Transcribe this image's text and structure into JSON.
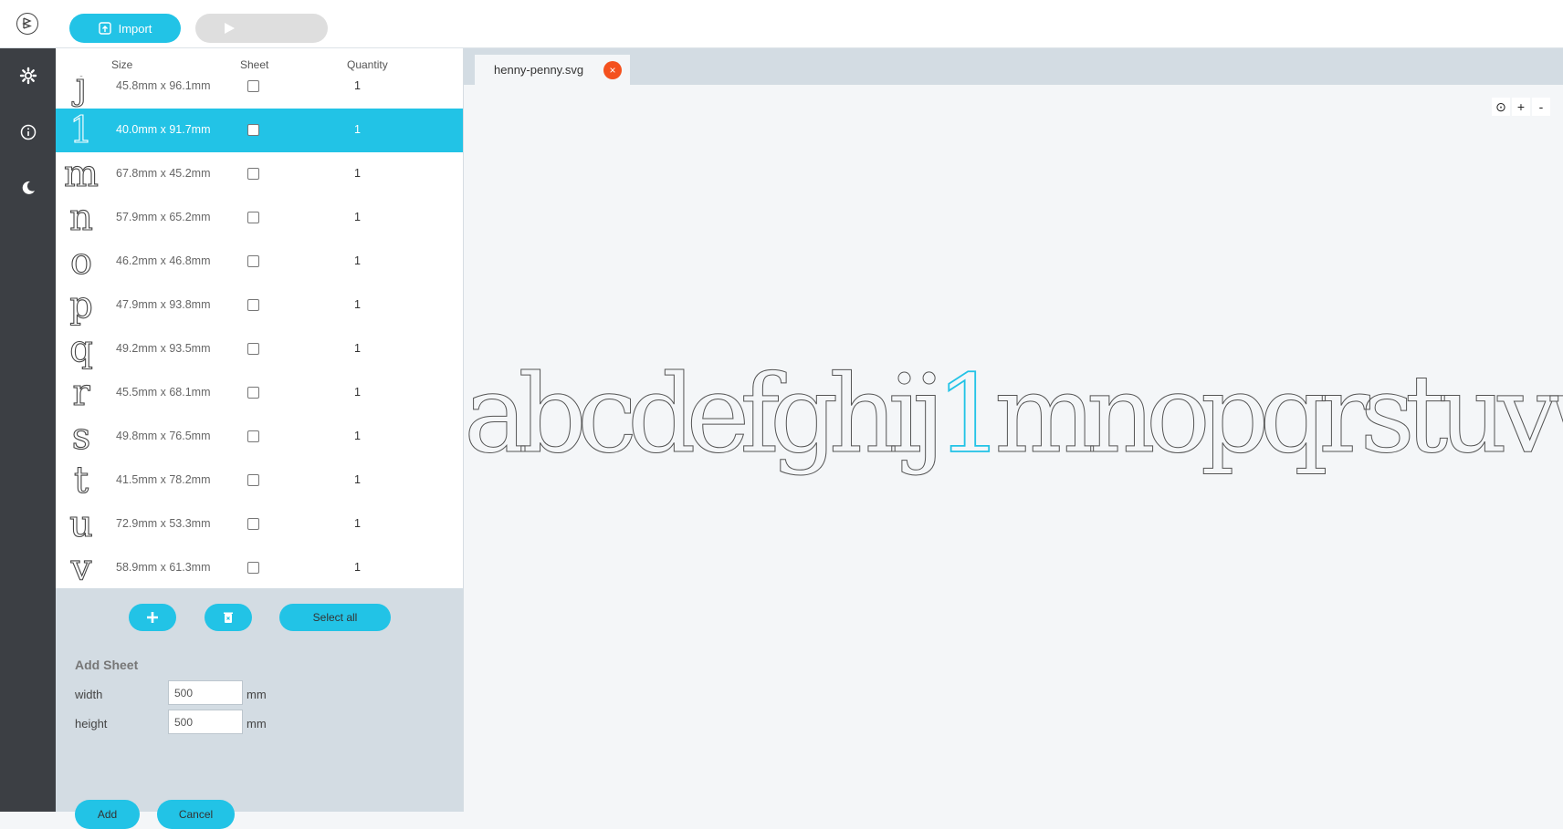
{
  "toolbar": {
    "import_label": "Import",
    "start_label": ""
  },
  "table": {
    "headers": {
      "size": "Size",
      "sheet": "Sheet",
      "quantity": "Quantity"
    },
    "rows": [
      {
        "glyph": "j",
        "size": "45.8mm x 96.1mm",
        "qty": "1"
      },
      {
        "glyph": "1",
        "size": "40.0mm x 91.7mm",
        "qty": "1",
        "selected": true
      },
      {
        "glyph": "m",
        "size": "67.8mm x 45.2mm",
        "qty": "1"
      },
      {
        "glyph": "n",
        "size": "57.9mm x 65.2mm",
        "qty": "1"
      },
      {
        "glyph": "o",
        "size": "46.2mm x 46.8mm",
        "qty": "1"
      },
      {
        "glyph": "p",
        "size": "47.9mm x 93.8mm",
        "qty": "1"
      },
      {
        "glyph": "q",
        "size": "49.2mm x 93.5mm",
        "qty": "1"
      },
      {
        "glyph": "r",
        "size": "45.5mm x 68.1mm",
        "qty": "1"
      },
      {
        "glyph": "s",
        "size": "49.8mm x 76.5mm",
        "qty": "1"
      },
      {
        "glyph": "t",
        "size": "41.5mm x 78.2mm",
        "qty": "1"
      },
      {
        "glyph": "u",
        "size": "72.9mm x 53.3mm",
        "qty": "1"
      },
      {
        "glyph": "v",
        "size": "58.9mm x 61.3mm",
        "qty": "1"
      }
    ]
  },
  "actions": {
    "select_all": "Select all"
  },
  "add_sheet": {
    "title": "Add Sheet",
    "width_label": "width",
    "width_value": "500",
    "height_label": "height",
    "height_value": "500",
    "unit": "mm",
    "add_label": "Add",
    "cancel_label": "Cancel"
  },
  "tab": {
    "filename": "henny-penny.svg",
    "close_glyph": "×"
  },
  "zoom": {
    "reset": "⊙",
    "in": "+",
    "out": "-"
  },
  "canvas": {
    "text_before": "abcdefghij",
    "highlight": "1",
    "text_after": "mnopqrstuvwxyz"
  },
  "colors": {
    "accent": "#22c3e6",
    "rail": "#3c3f44",
    "panel": "#d3dce3",
    "close": "#f4511e"
  }
}
